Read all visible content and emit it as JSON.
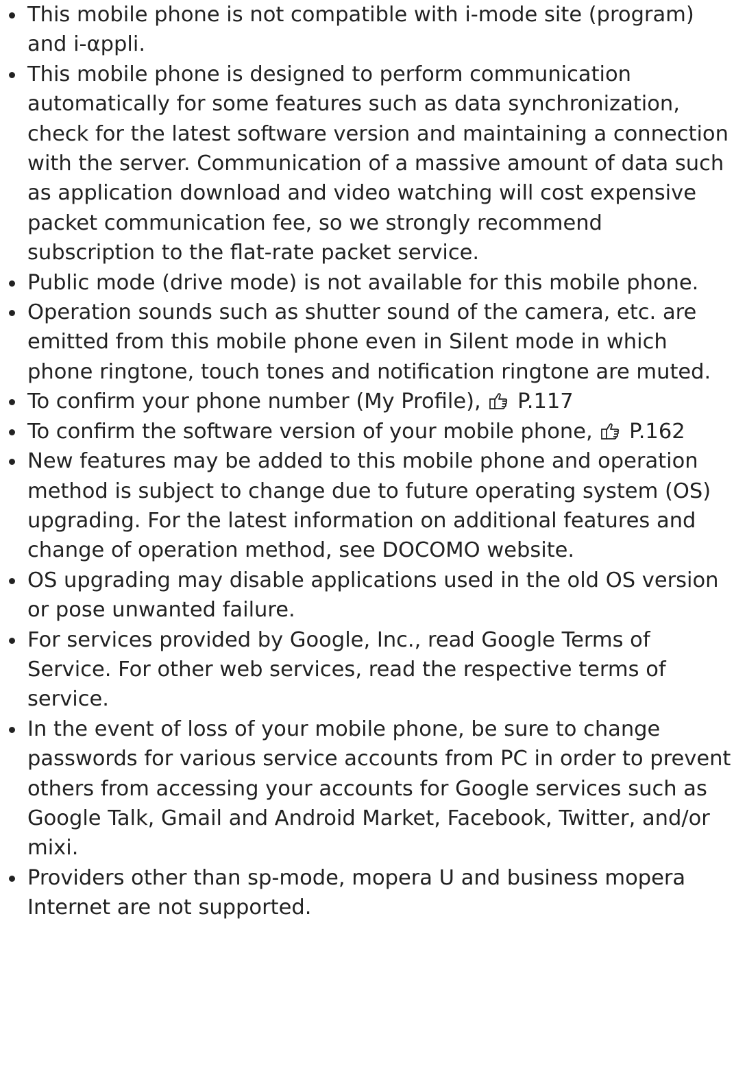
{
  "notes": [
    {
      "text": "This mobile phone is not compatible with i-mode site (program) and i-αppli."
    },
    {
      "text": "This mobile phone is designed to perform communication automatically for some features such as data synchronization, check for the latest software version and maintaining a connection with the server. Communication of a massive amount of data such as application download and video watching will cost expensive packet communication fee, so we strongly recommend subscription to the flat-rate packet service."
    },
    {
      "text": "Public mode (drive mode) is not available for this mobile phone."
    },
    {
      "text": "Operation sounds such as shutter sound of the camera, etc. are emitted from this mobile phone even in Silent mode in which phone ringtone, touch tones and notification ringtone are muted."
    },
    {
      "text": "To confirm your phone number (My Profile),",
      "ref": "P.117",
      "icon": "pointing-hand-icon"
    },
    {
      "text": "To confirm the software version of your mobile phone,",
      "ref": "P.162",
      "icon": "pointing-hand-icon"
    },
    {
      "text": "New features may be added to this mobile phone and operation method is subject to change due to future operating system (OS) upgrading. For the latest information on additional features and change of operation method, see DOCOMO website."
    },
    {
      "text": "OS upgrading may disable applications used in the old OS version or pose unwanted failure."
    },
    {
      "text": "For services provided by Google, Inc., read Google Terms of Service. For other web services, read the respective terms of service."
    },
    {
      "text": "In the event of loss of your mobile phone, be sure to change passwords for various service accounts from PC in order to prevent others from accessing your accounts for Google services such as Google Talk, Gmail and Android Market, Facebook, Twitter, and/or mixi."
    },
    {
      "text": "Providers other than sp-mode, mopera U and business mopera Internet are not supported."
    }
  ]
}
